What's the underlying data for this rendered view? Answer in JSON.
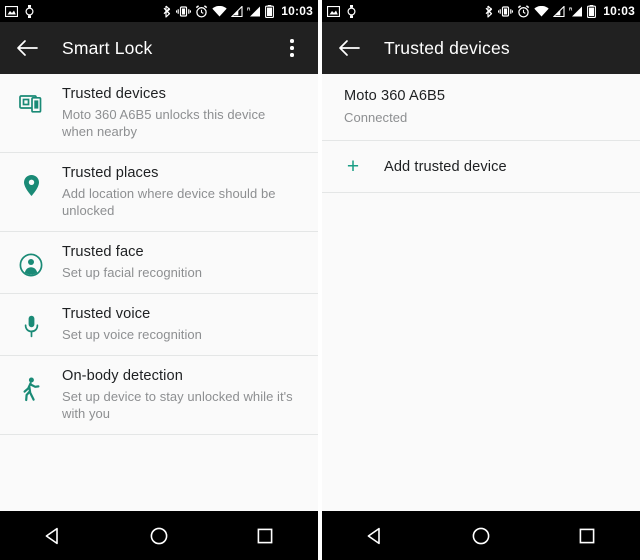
{
  "statusbar": {
    "left_icons": [
      "screenshot-icon",
      "watch-icon"
    ],
    "right_icons": [
      "bluetooth-icon",
      "vibrate-icon",
      "alarm-icon",
      "wifi-icon",
      "signal-icon",
      "roaming-signal-icon",
      "battery-icon"
    ],
    "clock": "10:03"
  },
  "accent_color": "#1a9e85",
  "left_screen": {
    "actionbar": {
      "back_icon": "arrow-back-icon",
      "title": "Smart Lock",
      "overflow_icon": "overflow-menu-icon"
    },
    "items": [
      {
        "icon": "devices-icon",
        "title": "Trusted devices",
        "subtitle": "Moto 360 A6B5 unlocks this device when nearby"
      },
      {
        "icon": "location-pin-icon",
        "title": "Trusted places",
        "subtitle": "Add location where device should be unlocked"
      },
      {
        "icon": "account-circle-icon",
        "title": "Trusted face",
        "subtitle": "Set up facial recognition"
      },
      {
        "icon": "microphone-icon",
        "title": "Trusted voice",
        "subtitle": "Set up voice recognition"
      },
      {
        "icon": "walking-person-icon",
        "title": "On-body detection",
        "subtitle": "Set up device to stay unlocked while it's with you"
      }
    ]
  },
  "right_screen": {
    "actionbar": {
      "back_icon": "arrow-back-icon",
      "title": "Trusted devices"
    },
    "device": {
      "name": "Moto 360 A6B5",
      "status": "Connected"
    },
    "add_row": {
      "icon": "plus-icon",
      "label": "Add trusted device"
    }
  },
  "navbar": {
    "back": "back-triangle-icon",
    "home": "home-circle-icon",
    "recents": "recents-square-icon"
  }
}
